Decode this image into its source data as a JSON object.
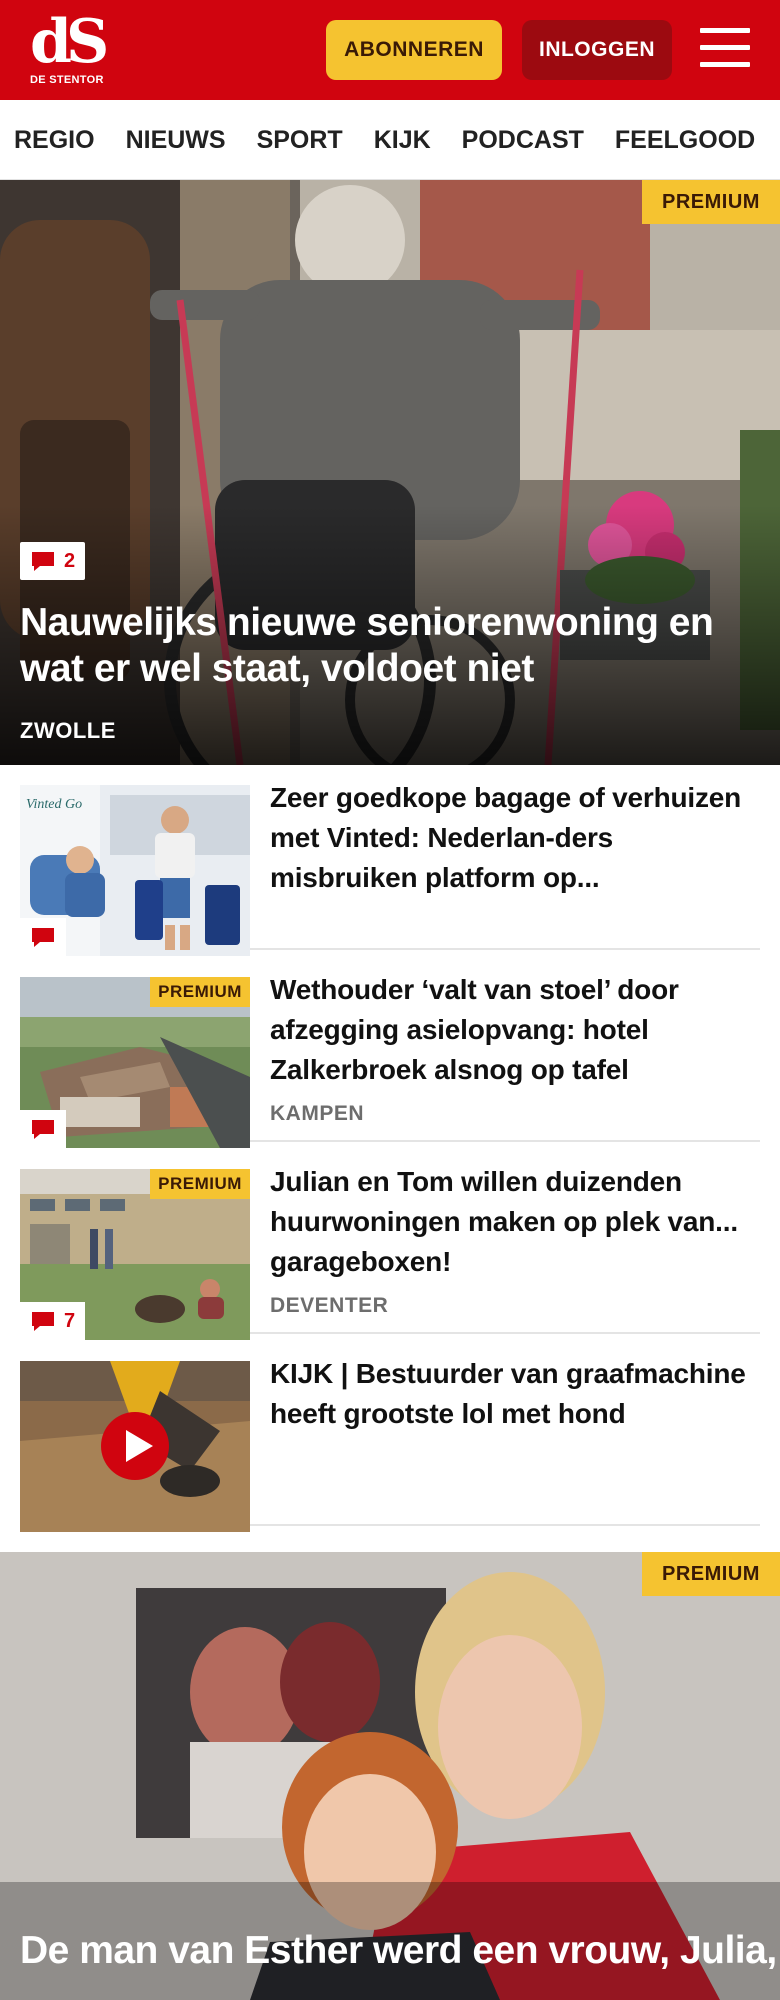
{
  "header": {
    "logo_mark": "dS",
    "logo_text": "DE STENTOR",
    "subscribe_label": "ABONNEREN",
    "login_label": "INLOGGEN",
    "menu_icon": "hamburger-menu-icon"
  },
  "nav": {
    "items": [
      "REGIO",
      "NIEUWS",
      "SPORT",
      "KIJK",
      "PODCAST",
      "FEELGOOD"
    ]
  },
  "hero": {
    "badge": "PREMIUM",
    "comment_count": "2",
    "title": "Nauwelijks nieuwe seniorenwoning en wat er wel staat, voldoet niet",
    "category": "ZWOLLE"
  },
  "articles": [
    {
      "title": "Zeer goedkope bagage of verhuizen met Vinted: Nederlan-ders misbruiken platform op...",
      "thumb_sign": "Vinted Go",
      "comment_count": ""
    },
    {
      "badge": "PREMIUM",
      "title": "Wethouder ‘valt van stoel’ door afzegging asielopvang: hotel Zalkerbroek alsnog op tafel",
      "category": "KAMPEN",
      "comment_count": ""
    },
    {
      "badge": "PREMIUM",
      "title": "Julian en Tom willen duizenden huurwoningen maken op plek van... garageboxen!",
      "category": "DEVENTER",
      "comment_count": "7"
    },
    {
      "title": "KIJK | Bestuurder van graafmachine heeft grootste lol met hond",
      "video_icon": "play-icon"
    }
  ],
  "hero2": {
    "badge": "PREMIUM",
    "title": "De man van Esther werd een vrouw, Julia, en ze zijn dolgelukkig: ‘We"
  },
  "colors": {
    "brand_red": "#d0040f",
    "premium_yellow": "#f5c330",
    "login_dark_red": "#9c0a10"
  }
}
